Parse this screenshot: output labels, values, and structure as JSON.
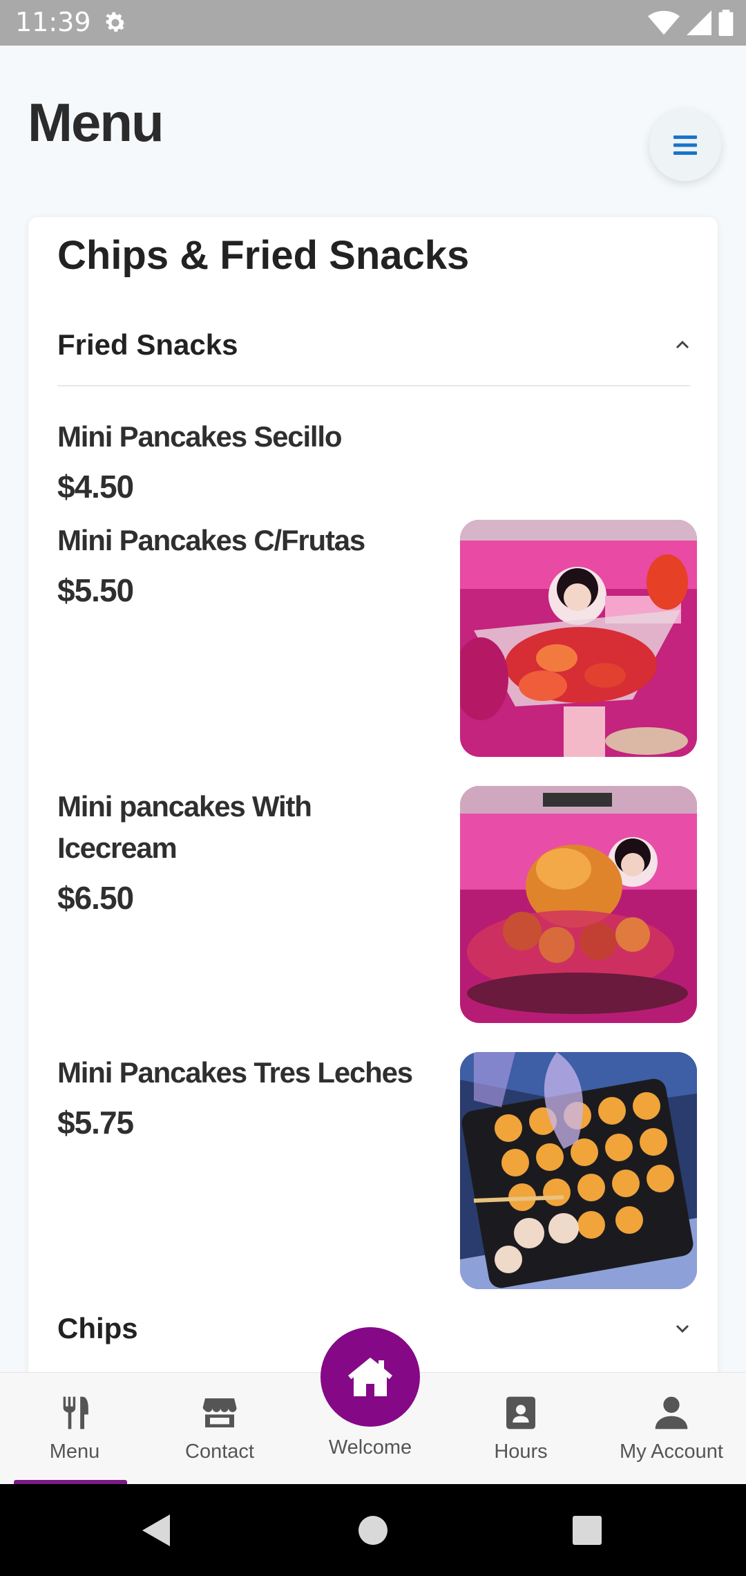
{
  "status_bar": {
    "time": "11:39",
    "icons": [
      "settings-gear-icon",
      "wifi-icon",
      "signal-icon",
      "battery-icon"
    ]
  },
  "header": {
    "title": "Menu",
    "menu_button_icon": "hamburger-menu-icon"
  },
  "category": {
    "title": "Chips & Fried Snacks",
    "sections": [
      {
        "label": "Fried Snacks",
        "expanded": true,
        "items": [
          {
            "name": "Mini Pancakes Secillo",
            "price": "$4.50",
            "has_photo": false
          },
          {
            "name": "Mini Pancakes C/Frutas",
            "price": "$5.50",
            "has_photo": true
          },
          {
            "name": "Mini pancakes With Icecream",
            "price": "$6.50",
            "has_photo": true
          },
          {
            "name": "Mini Pancakes Tres Leches",
            "price": "$5.75",
            "has_photo": true
          }
        ]
      },
      {
        "label": "Chips",
        "expanded": false
      }
    ]
  },
  "bottom_nav": {
    "items": [
      {
        "label": "Menu",
        "icon": "fork-knife-icon",
        "active": true
      },
      {
        "label": "Contact",
        "icon": "storefront-icon",
        "active": false
      },
      {
        "label": "Welcome",
        "icon": "home-icon",
        "active": false
      },
      {
        "label": "Hours",
        "icon": "contact-card-icon",
        "active": false
      },
      {
        "label": "My Account",
        "icon": "person-icon",
        "active": false
      }
    ]
  },
  "colors": {
    "accent": "#850987",
    "menu_icon": "#1a73c8",
    "nav_icon": "#555555",
    "status_bar": "#a9a9a9"
  }
}
